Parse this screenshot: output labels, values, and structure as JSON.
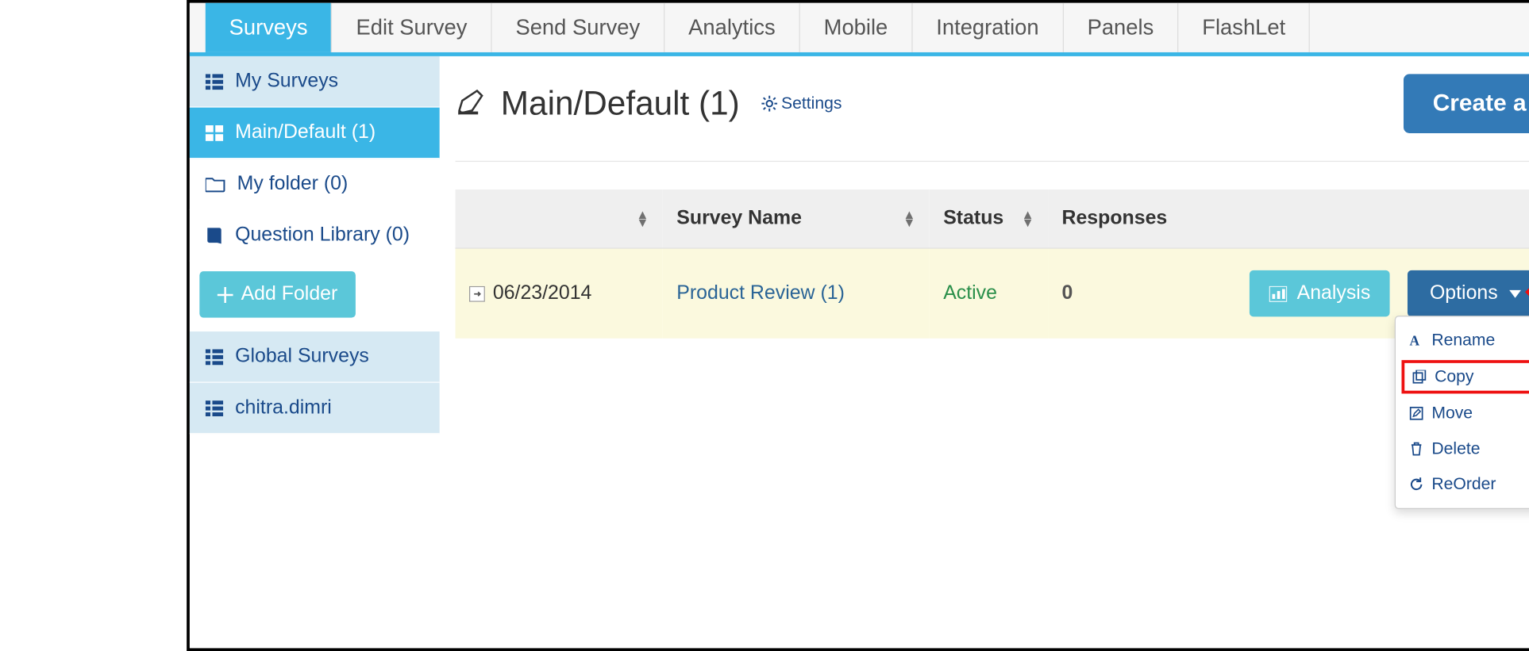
{
  "nav": {
    "tabs": [
      "Surveys",
      "Edit Survey",
      "Send Survey",
      "Analytics",
      "Mobile",
      "Integration",
      "Panels",
      "FlashLet"
    ],
    "active_index": 0
  },
  "sidebar": {
    "my_surveys": "My Surveys",
    "main_default": "Main/Default (1)",
    "my_folder": "My folder (0)",
    "question_library": "Question Library (0)",
    "add_folder": "Add Folder",
    "global_surveys": "Global Surveys",
    "user": "chitra.dimri"
  },
  "header": {
    "title": "Main/Default (1)",
    "settings": "Settings",
    "create_button": "Create a New Survey"
  },
  "table": {
    "columns": {
      "date": "",
      "name": "Survey Name",
      "status": "Status",
      "responses": "Responses"
    },
    "row": {
      "date": "06/23/2014",
      "name": "Product Review (1)",
      "status": "Active",
      "responses": "0",
      "analysis_btn": "Analysis",
      "options_btn": "Options"
    }
  },
  "dropdown": {
    "rename": "Rename",
    "copy": "Copy",
    "move": "Move",
    "delete": "Delete",
    "reorder": "ReOrder"
  }
}
